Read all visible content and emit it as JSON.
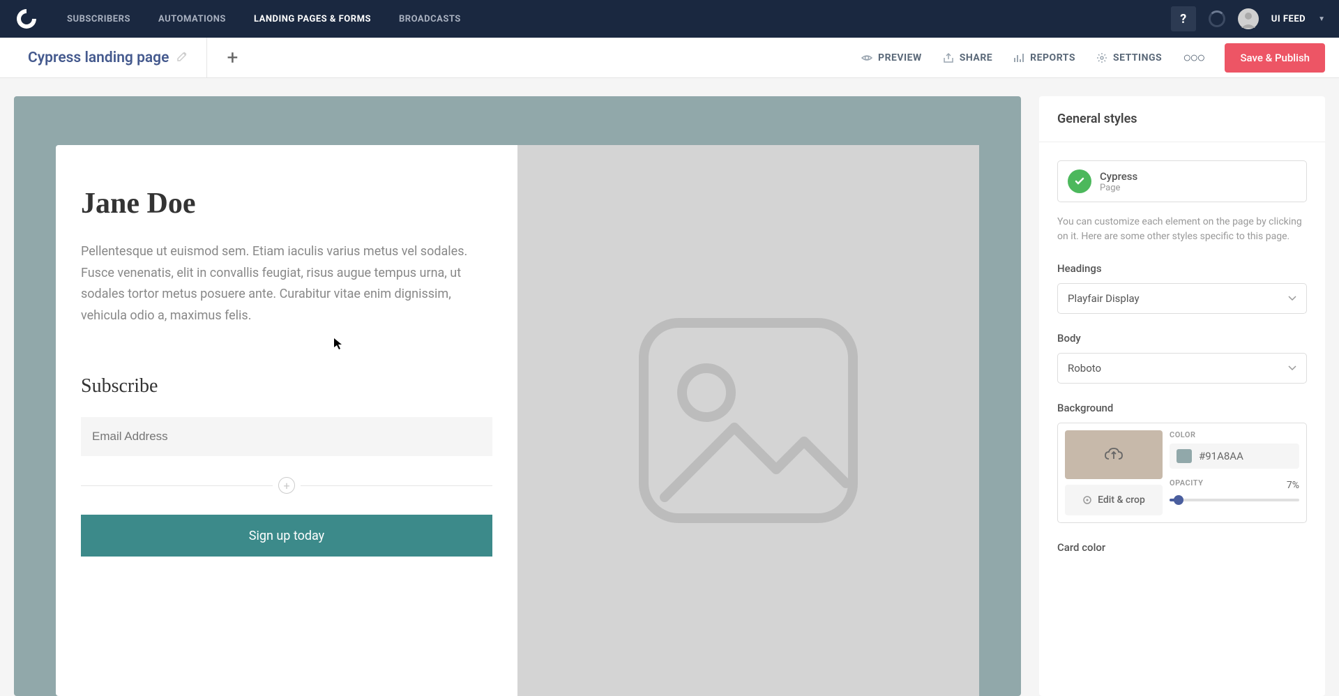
{
  "nav": {
    "items": [
      "SUBSCRIBERS",
      "AUTOMATIONS",
      "LANDING PAGES & FORMS",
      "BROADCASTS"
    ],
    "active_index": 2,
    "help": "?",
    "user": "UI FEED"
  },
  "subheader": {
    "title": "Cypress landing page",
    "actions": {
      "preview": "PREVIEW",
      "share": "SHARE",
      "reports": "REPORTS",
      "settings": "SETTINGS"
    },
    "save": "Save & Publish"
  },
  "canvas": {
    "heading": "Jane Doe",
    "body": "Pellentesque ut euismod sem. Etiam iaculis varius metus vel sodales. Fusce venenatis, elit in convallis feugiat, risus augue tempus urna, ut sodales tortor metus posuere ante. Curabitur vitae enim dignissim, vehicula odio a, maximus felis.",
    "subscribe_heading": "Subscribe",
    "email_placeholder": "Email Address",
    "button": "Sign up today"
  },
  "sidebar": {
    "title": "General styles",
    "template": {
      "name": "Cypress",
      "sub": "Page"
    },
    "hint": "You can customize each element on the page by clicking on it. Here are some other styles specific to this page.",
    "headings_label": "Headings",
    "headings_value": "Playfair Display",
    "body_label": "Body",
    "body_value": "Roboto",
    "background_label": "Background",
    "color_label": "COLOR",
    "color_value": "#91A8AA",
    "edit_crop": "Edit & crop",
    "opacity_label": "OPACITY",
    "opacity_value": "7%",
    "opacity_percent": 7,
    "card_color_label": "Card color"
  }
}
